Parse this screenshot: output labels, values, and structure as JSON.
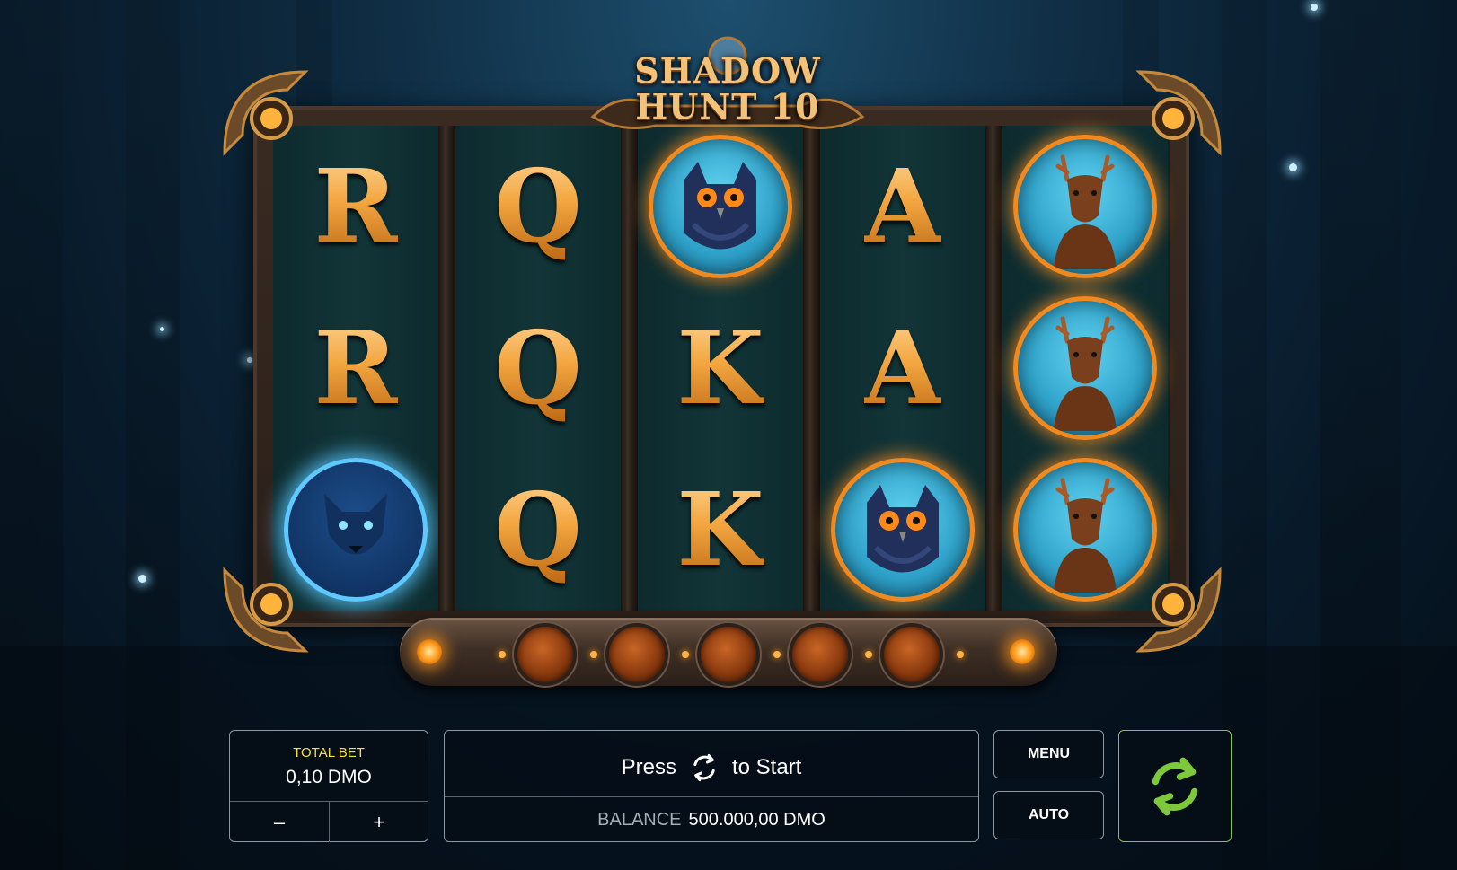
{
  "title": {
    "line1": "SHADOW",
    "line2": "HUNT 10"
  },
  "reels": [
    [
      "R",
      "R",
      "wolf"
    ],
    [
      "Q",
      "Q",
      "Q"
    ],
    [
      "owl",
      "K",
      "K"
    ],
    [
      "A",
      "A",
      "owl"
    ],
    [
      "stag",
      "stag",
      "stag"
    ]
  ],
  "paylines": 5,
  "bet": {
    "label": "TOTAL BET",
    "value": "0,10 DMO",
    "minus": "–",
    "plus": "+"
  },
  "info": {
    "press": "Press",
    "to_start": "to Start",
    "balance_label": "BALANCE",
    "balance_value": "500.000,00 DMO"
  },
  "buttons": {
    "menu": "MENU",
    "auto": "AUTO"
  },
  "icons": {
    "spin": "spin-arrows-icon"
  },
  "colors": {
    "accent": "#7dc93b",
    "gold": "#f3a640",
    "bet_label": "#f6e33a"
  }
}
